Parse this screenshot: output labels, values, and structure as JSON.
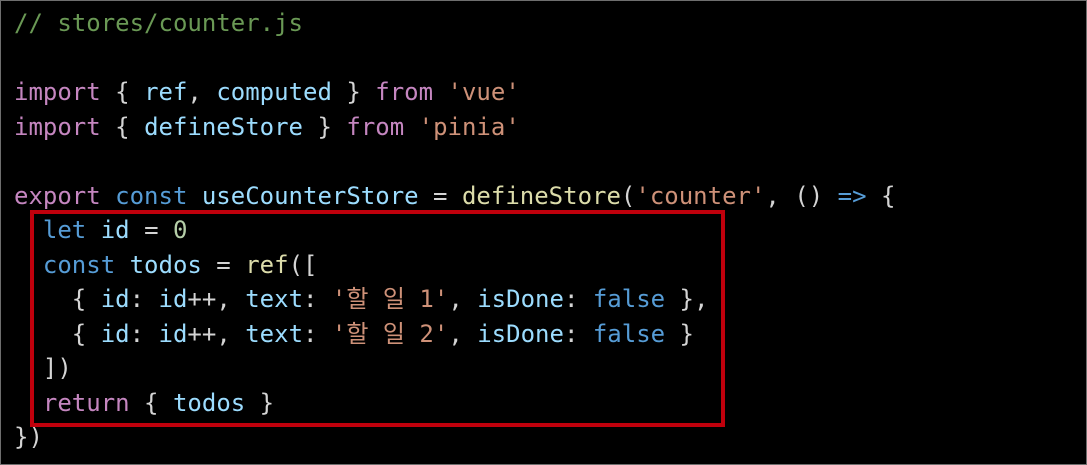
{
  "colors": {
    "background": "#000000",
    "comment": "#6a9955",
    "keyword": "#c586c0",
    "storage": "#569cd6",
    "variable": "#9cdcfe",
    "function": "#dcdcaa",
    "string": "#ce9178",
    "number": "#b5cea8",
    "punctuation": "#d4d4d4",
    "highlight_box": "#c0000c"
  },
  "code": {
    "lines": [
      [
        {
          "t": "// stores/counter.js",
          "k": "comment"
        }
      ],
      [],
      [
        {
          "t": "import",
          "k": "keyword"
        },
        {
          "t": " { ",
          "k": "punctuation"
        },
        {
          "t": "ref",
          "k": "variable"
        },
        {
          "t": ", ",
          "k": "punctuation"
        },
        {
          "t": "computed",
          "k": "variable"
        },
        {
          "t": " } ",
          "k": "punctuation"
        },
        {
          "t": "from",
          "k": "keyword"
        },
        {
          "t": " ",
          "k": "punctuation"
        },
        {
          "t": "'vue'",
          "k": "string"
        }
      ],
      [
        {
          "t": "import",
          "k": "keyword"
        },
        {
          "t": " { ",
          "k": "punctuation"
        },
        {
          "t": "defineStore",
          "k": "variable"
        },
        {
          "t": " } ",
          "k": "punctuation"
        },
        {
          "t": "from",
          "k": "keyword"
        },
        {
          "t": " ",
          "k": "punctuation"
        },
        {
          "t": "'pinia'",
          "k": "string"
        }
      ],
      [],
      [
        {
          "t": "export",
          "k": "keyword"
        },
        {
          "t": " ",
          "k": "punctuation"
        },
        {
          "t": "const",
          "k": "storage"
        },
        {
          "t": " ",
          "k": "punctuation"
        },
        {
          "t": "useCounterStore",
          "k": "variable"
        },
        {
          "t": " = ",
          "k": "punctuation"
        },
        {
          "t": "defineStore",
          "k": "function"
        },
        {
          "t": "(",
          "k": "punctuation"
        },
        {
          "t": "'counter'",
          "k": "string"
        },
        {
          "t": ", () ",
          "k": "punctuation"
        },
        {
          "t": "=>",
          "k": "storage"
        },
        {
          "t": " {",
          "k": "punctuation"
        }
      ],
      [
        {
          "t": "  ",
          "k": "punctuation"
        },
        {
          "t": "let",
          "k": "storage"
        },
        {
          "t": " ",
          "k": "punctuation"
        },
        {
          "t": "id",
          "k": "variable"
        },
        {
          "t": " = ",
          "k": "punctuation"
        },
        {
          "t": "0",
          "k": "number"
        }
      ],
      [
        {
          "t": "  ",
          "k": "punctuation"
        },
        {
          "t": "const",
          "k": "storage"
        },
        {
          "t": " ",
          "k": "punctuation"
        },
        {
          "t": "todos",
          "k": "variable"
        },
        {
          "t": " = ",
          "k": "punctuation"
        },
        {
          "t": "ref",
          "k": "function"
        },
        {
          "t": "([",
          "k": "punctuation"
        }
      ],
      [
        {
          "t": "    { ",
          "k": "punctuation"
        },
        {
          "t": "id",
          "k": "variable"
        },
        {
          "t": ": ",
          "k": "punctuation"
        },
        {
          "t": "id",
          "k": "variable"
        },
        {
          "t": "++, ",
          "k": "punctuation"
        },
        {
          "t": "text",
          "k": "variable"
        },
        {
          "t": ": ",
          "k": "punctuation"
        },
        {
          "t": "'할 일 1'",
          "k": "string"
        },
        {
          "t": ", ",
          "k": "punctuation"
        },
        {
          "t": "isDone",
          "k": "variable"
        },
        {
          "t": ": ",
          "k": "punctuation"
        },
        {
          "t": "false",
          "k": "storage"
        },
        {
          "t": " },",
          "k": "punctuation"
        }
      ],
      [
        {
          "t": "    { ",
          "k": "punctuation"
        },
        {
          "t": "id",
          "k": "variable"
        },
        {
          "t": ": ",
          "k": "punctuation"
        },
        {
          "t": "id",
          "k": "variable"
        },
        {
          "t": "++, ",
          "k": "punctuation"
        },
        {
          "t": "text",
          "k": "variable"
        },
        {
          "t": ": ",
          "k": "punctuation"
        },
        {
          "t": "'할 일 2'",
          "k": "string"
        },
        {
          "t": ", ",
          "k": "punctuation"
        },
        {
          "t": "isDone",
          "k": "variable"
        },
        {
          "t": ": ",
          "k": "punctuation"
        },
        {
          "t": "false",
          "k": "storage"
        },
        {
          "t": " }",
          "k": "punctuation"
        }
      ],
      [
        {
          "t": "  ])",
          "k": "punctuation"
        }
      ],
      [
        {
          "t": "  ",
          "k": "punctuation"
        },
        {
          "t": "return",
          "k": "keyword"
        },
        {
          "t": " { ",
          "k": "punctuation"
        },
        {
          "t": "todos",
          "k": "variable"
        },
        {
          "t": " }",
          "k": "punctuation"
        }
      ],
      [
        {
          "t": "})",
          "k": "punctuation"
        }
      ]
    ]
  }
}
